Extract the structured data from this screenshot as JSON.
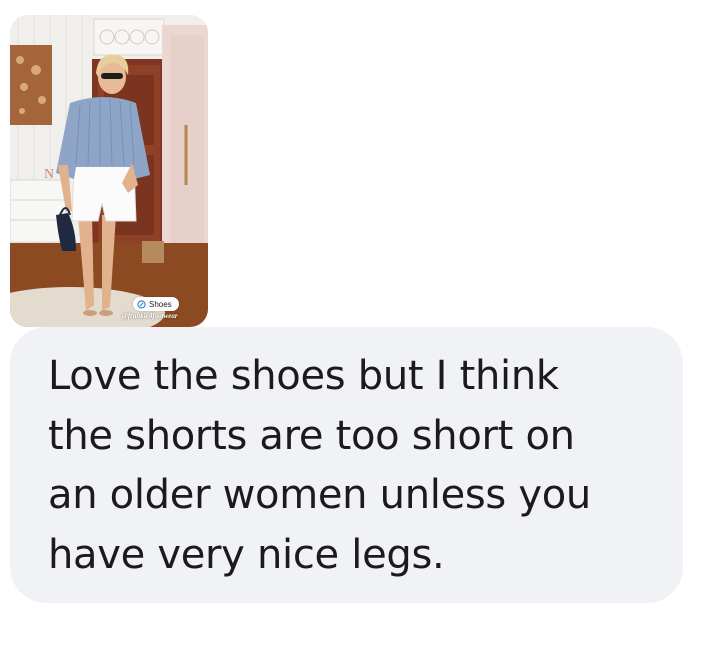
{
  "shared_post": {
    "image_alt": "Woman in blue striped shirt and white shorts holding a small navy bag",
    "tag_label": "Shoes",
    "tag_icon": "link-icon",
    "handle": "@frankie4footwear"
  },
  "message": {
    "lines": [
      "Love the shoes but I think",
      "the shorts are too short on",
      "an older women unless you",
      "have very nice legs."
    ]
  },
  "colors": {
    "bubble_background": "#f1f2f6",
    "text": "#1b1b1c",
    "page_background": "#ffffff"
  }
}
